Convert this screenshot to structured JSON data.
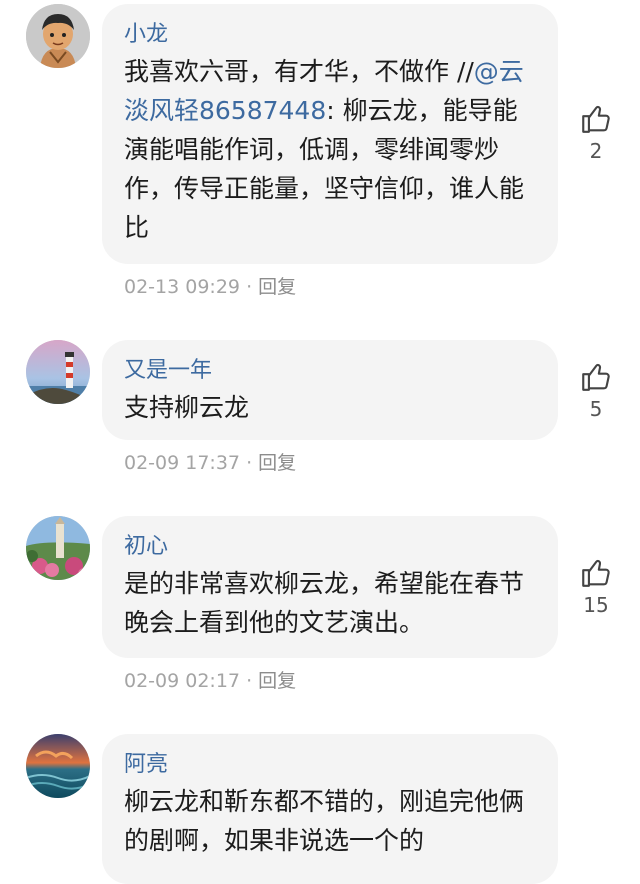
{
  "comments": [
    {
      "username": "小龙",
      "text_before": "我喜欢六哥，有才华，不做作 //",
      "mention": "@云淡风轻86587448",
      "text_after": ": 柳云龙，能导能演能唱能作词，低调，零绯闻零炒作，传导正能量，坚守信仰，谁人能比",
      "time": "02-13 09:29",
      "separator": "·",
      "reply_label": "回复",
      "likes": "2",
      "avatar_icon": "cartoon-boy-avatar-icon"
    },
    {
      "username": "又是一年",
      "text": "支持柳云龙",
      "time": "02-09 17:37",
      "separator": "·",
      "reply_label": "回复",
      "likes": "5",
      "avatar_icon": "lighthouse-avatar-icon"
    },
    {
      "username": "初心",
      "text": "是的非常喜欢柳云龙，希望能在春节晚会上看到他的文艺演出。",
      "time": "02-09 02:17",
      "separator": "·",
      "reply_label": "回复",
      "likes": "15",
      "avatar_icon": "tower-flowers-avatar-icon"
    },
    {
      "username": "阿亮",
      "text": "柳云龙和靳东都不错的，刚追完他俩的剧啊，如果非说选一个的",
      "avatar_icon": "ocean-sunset-avatar-icon"
    }
  ],
  "colors": {
    "username": "#3d6aa0",
    "bubble": "#f4f4f4",
    "meta": "#a4a4a4"
  },
  "icons": {
    "like": "thumbs-up-icon"
  }
}
